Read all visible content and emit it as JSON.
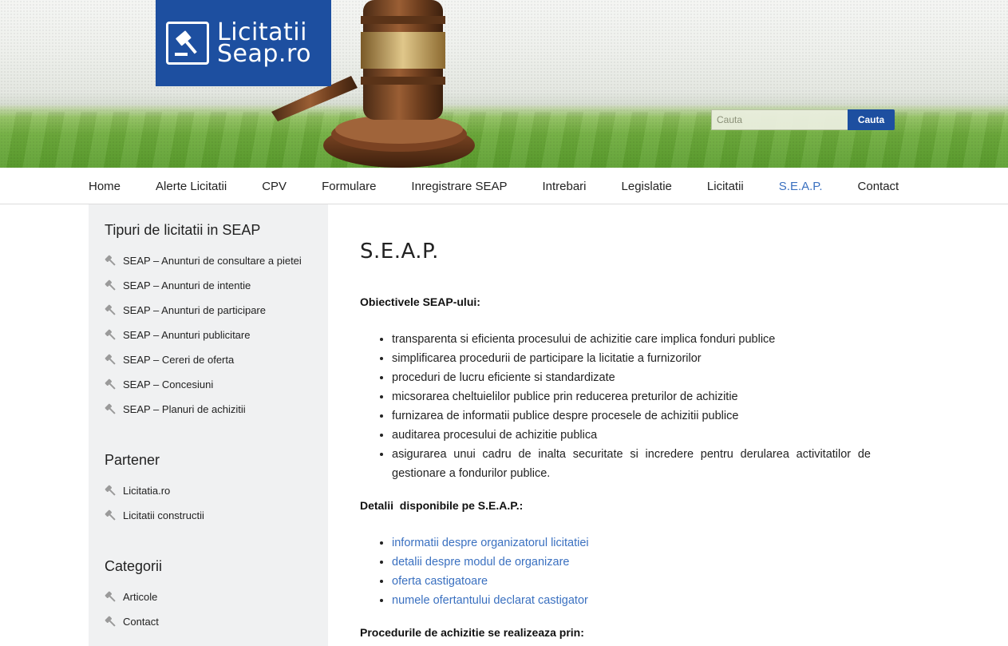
{
  "logo": {
    "line1": "Licitatii",
    "line2": "Seap.ro"
  },
  "search": {
    "placeholder": "Cauta",
    "button": "Cauta"
  },
  "nav": {
    "items": [
      "Home",
      "Alerte Licitatii",
      "CPV",
      "Formulare",
      "Inregistrare SEAP",
      "Intrebari",
      "Legislatie",
      "Licitatii",
      "S.E.A.P.",
      "Contact"
    ],
    "active": "S.E.A.P."
  },
  "sidebar": {
    "tipuri": {
      "title": "Tipuri de licitatii in SEAP",
      "items": [
        "SEAP – Anunturi de consultare a pietei",
        "SEAP – Anunturi de intentie",
        "SEAP – Anunturi de participare",
        "SEAP – Anunturi publicitare",
        "SEAP – Cereri de oferta",
        "SEAP – Concesiuni",
        "SEAP – Planuri de achizitii"
      ]
    },
    "partener": {
      "title": "Partener",
      "items": [
        "Licitatia.ro",
        "Licitatii constructii"
      ]
    },
    "categorii": {
      "title": "Categorii",
      "items": [
        "Articole",
        "Contact"
      ]
    }
  },
  "main": {
    "title": "S.E.A.P.",
    "objectives_heading": "Obiectivele SEAP-ului:",
    "objectives": [
      "transparenta si eficienta procesului de achizitie care implica fonduri publice",
      "simplificarea procedurii de participare la licitatie a furnizorilor",
      "proceduri de lucru eficiente si standardizate",
      "micsorarea cheltuielilor publice prin reducerea preturilor de achizitie",
      "furnizarea de informatii publice despre procesele de achizitii publice",
      "auditarea procesului de achizitie publica",
      "asigurarea unui cadru de inalta securitate si incredere pentru derularea activitatilor de gestionare a fondurilor publice."
    ],
    "details_heading": "Detalii  disponibile pe S.E.A.P.:",
    "details": [
      "informatii despre organizatorul licitatiei",
      "detalii despre modul de organizare",
      "oferta castigatoare",
      "numele ofertantului declarat castigator"
    ],
    "procedures_heading": "Procedurile de achizitie se realizeaza prin:"
  },
  "colors": {
    "brand": "#1d4fa0",
    "link": "#3a70c0",
    "sidebar_bg": "#f0f1f2"
  }
}
